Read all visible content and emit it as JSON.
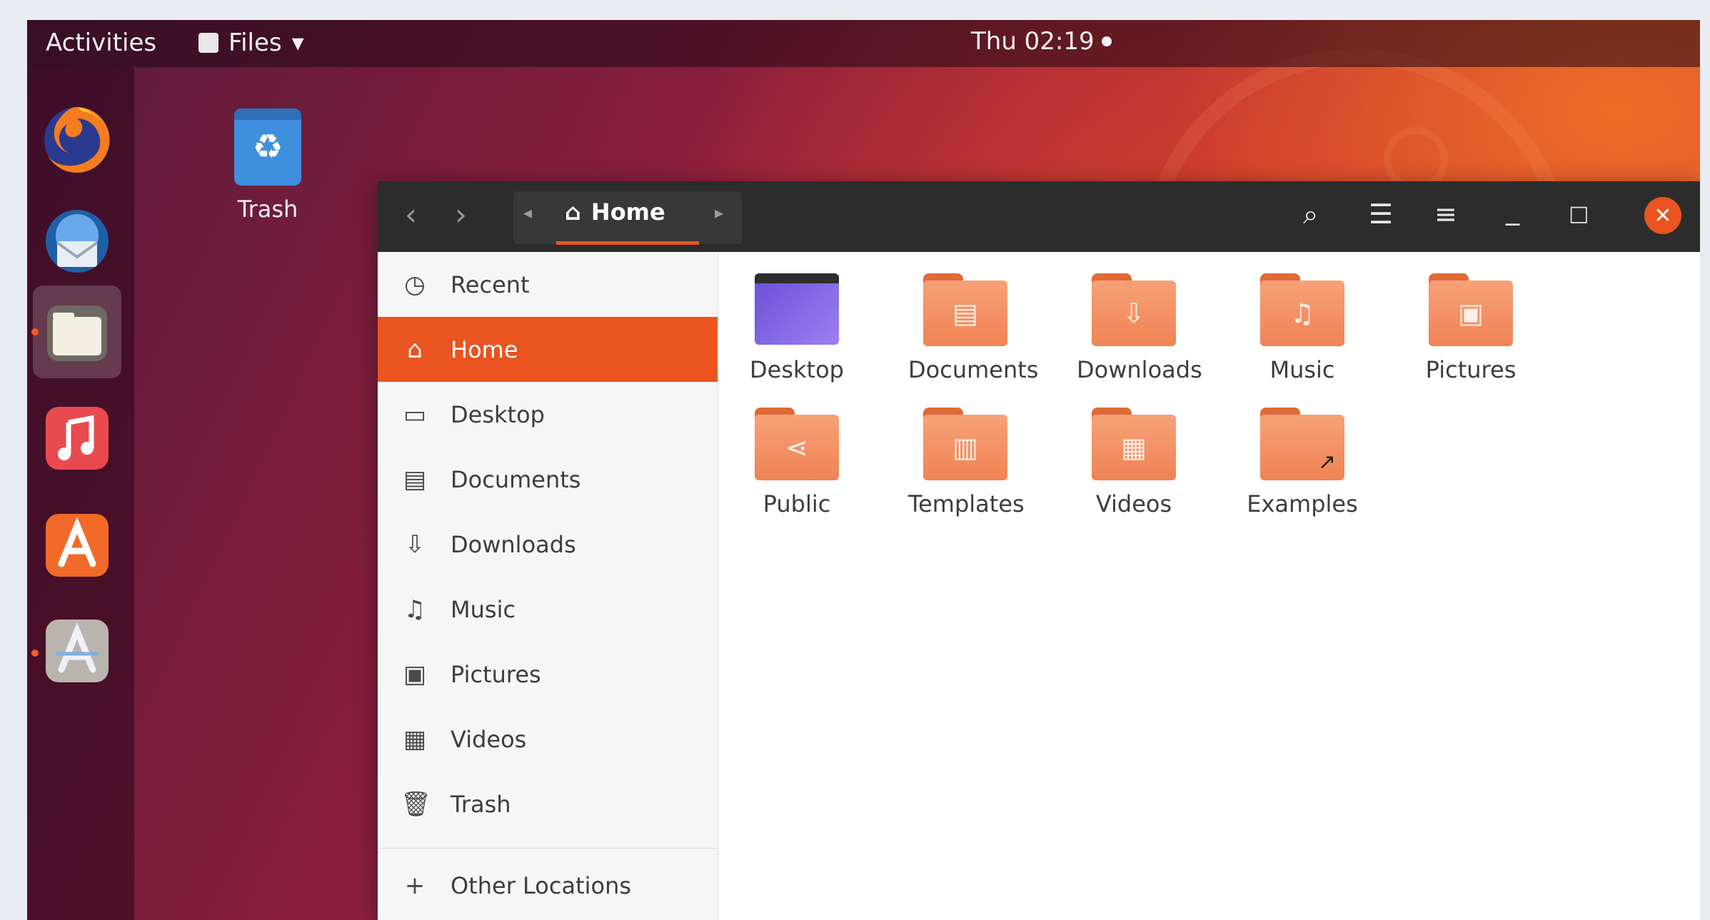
{
  "topbar": {
    "activities": "Activities",
    "app_menu": "Files",
    "app_menu_arrow": "▾",
    "clock": "Thu 02:19"
  },
  "dock": {
    "apps": [
      {
        "name": "firefox-icon"
      },
      {
        "name": "thunderbird-icon"
      },
      {
        "name": "files-icon",
        "active": true
      },
      {
        "name": "rhythmbox-icon"
      },
      {
        "name": "software-center-icon"
      },
      {
        "name": "software-updater-icon"
      }
    ]
  },
  "desktop": {
    "trash_label": "Trash"
  },
  "window": {
    "path_home": "Home",
    "sidebar": [
      {
        "label": "Recent",
        "icon": "◷",
        "name": "recent"
      },
      {
        "label": "Home",
        "icon": "⌂",
        "name": "home",
        "active": true
      },
      {
        "label": "Desktop",
        "icon": "▭",
        "name": "desktop"
      },
      {
        "label": "Documents",
        "icon": "▤",
        "name": "documents"
      },
      {
        "label": "Downloads",
        "icon": "⇩",
        "name": "downloads"
      },
      {
        "label": "Music",
        "icon": "♫",
        "name": "music"
      },
      {
        "label": "Pictures",
        "icon": "▣",
        "name": "pictures"
      },
      {
        "label": "Videos",
        "icon": "▦",
        "name": "videos"
      },
      {
        "label": "Trash",
        "icon": "🗑",
        "name": "trash"
      },
      {
        "label": "Other Locations",
        "icon": "+",
        "name": "other-locations"
      }
    ],
    "folders": [
      {
        "label": "Desktop",
        "glyph": "",
        "kind": "desk"
      },
      {
        "label": "Documents",
        "glyph": "▤"
      },
      {
        "label": "Downloads",
        "glyph": "⇩"
      },
      {
        "label": "Music",
        "glyph": "♫"
      },
      {
        "label": "Pictures",
        "glyph": "▣"
      },
      {
        "label": "Public",
        "glyph": "⋖"
      },
      {
        "label": "Templates",
        "glyph": "▥"
      },
      {
        "label": "Videos",
        "glyph": "▦"
      },
      {
        "label": "Examples",
        "glyph": "",
        "link": "↗"
      }
    ],
    "colors": {
      "accent": "#e95420",
      "header": "#2c2c2c"
    }
  }
}
